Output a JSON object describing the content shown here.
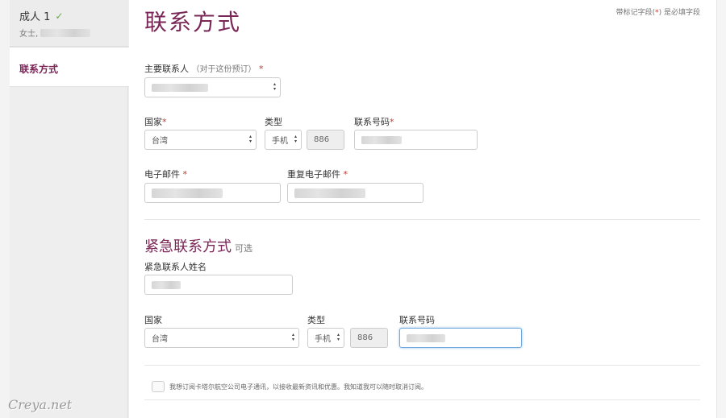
{
  "sidebar": {
    "passenger_label": "成人 1",
    "passenger_sub": "女士,",
    "active_item": "联系方式"
  },
  "main": {
    "title": "联系方式",
    "required_note_prefix": "带标记字段(",
    "required_note_star": "*",
    "required_note_suffix": ") 是必填字段",
    "primary_contact": {
      "label": "主要联系人",
      "hint": "（对于这份预订）",
      "req": "*"
    },
    "contact": {
      "country_label": "国家",
      "country_value": "台湾",
      "type_label": "类型",
      "type_value": "手机",
      "code_value": "886",
      "phone_label": "联系号码",
      "req": "*"
    },
    "email": {
      "label": "电子邮件",
      "repeat_label": "重复电子邮件",
      "req": "*"
    },
    "emergency": {
      "title": "紧急联系方式",
      "optional": "可选",
      "name_label": "紧急联系人姓名",
      "country_label": "国家",
      "country_value": "台湾",
      "type_label": "类型",
      "type_value": "手机",
      "code_value": "886",
      "phone_label": "联系号码"
    },
    "subscribe_text": "我想订阅卡塔尔航空公司电子通讯，以接收最新资讯和优惠。我知道我可以随时取消订阅。"
  },
  "watermark": "Creya.net",
  "colors": {
    "brand": "#7a2657",
    "required": "#c0392b",
    "focus": "#6fa8dc"
  }
}
